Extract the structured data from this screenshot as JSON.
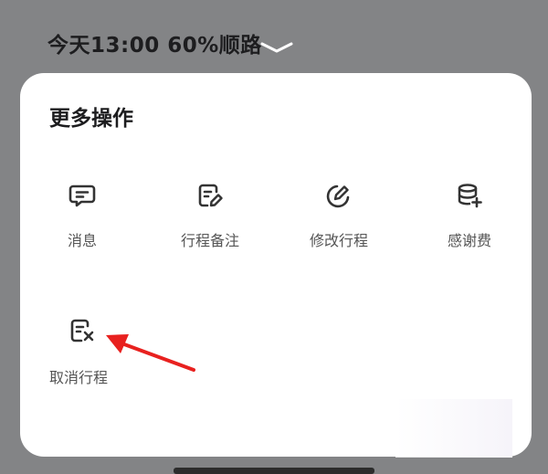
{
  "status": {
    "trip_summary": "今天13:00  60%顺路"
  },
  "sheet": {
    "title": "更多操作",
    "actions": [
      {
        "label": "消息",
        "icon": "message-icon"
      },
      {
        "label": "行程备注",
        "icon": "trip-note-icon"
      },
      {
        "label": "修改行程",
        "icon": "edit-trip-icon"
      },
      {
        "label": "感谢费",
        "icon": "thank-fee-icon"
      },
      {
        "label": "取消行程",
        "icon": "cancel-trip-icon"
      }
    ]
  },
  "colors": {
    "backdrop": "#838486",
    "sheet": "#ffffff",
    "text": "#1d1d1f",
    "label": "#555555",
    "annotation_arrow": "#e8211f"
  }
}
